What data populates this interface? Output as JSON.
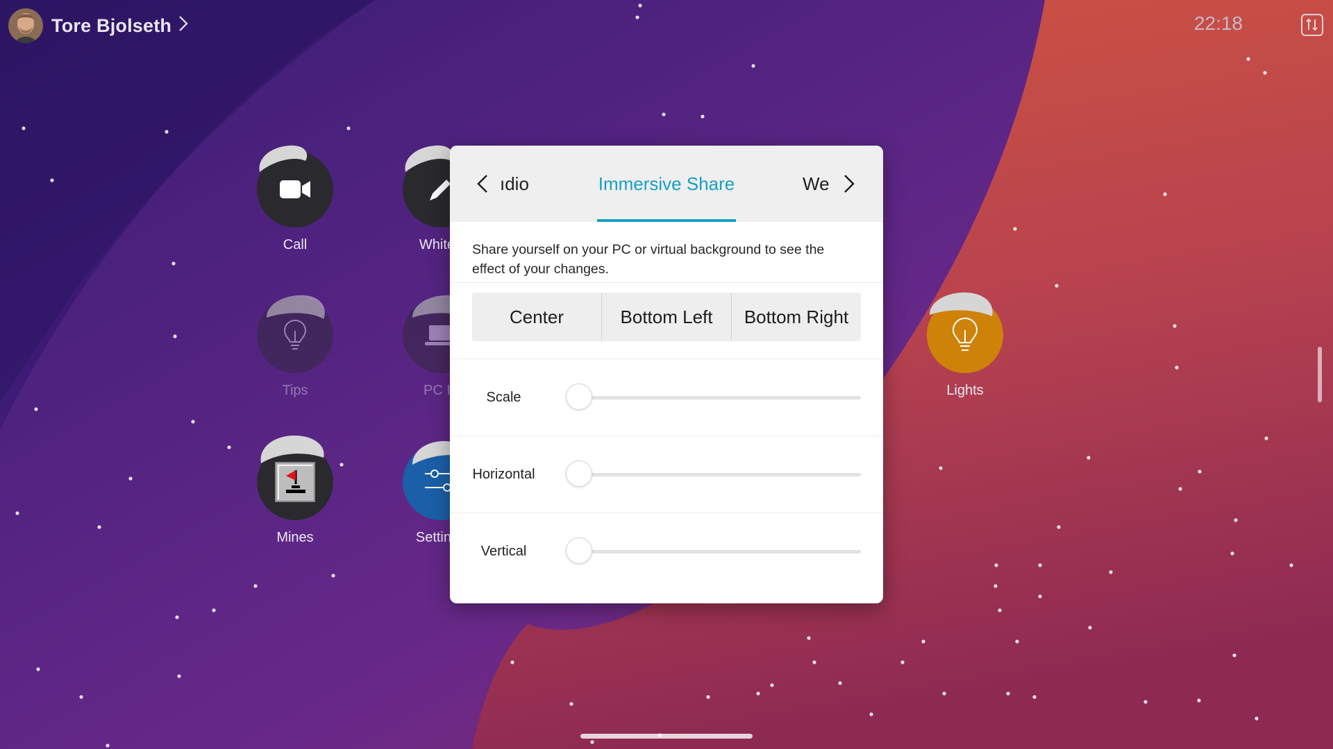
{
  "user": {
    "name": "Tore Bjolseth",
    "chevron": ">"
  },
  "clock": "22:18",
  "tiles": [
    {
      "label": "Call",
      "icon": "video-camera-icon",
      "color": "#2a2a2e"
    },
    {
      "label": "Whiteb",
      "icon": "pen-icon",
      "color": "#2a2a2e"
    },
    {
      "label": "Tips",
      "icon": "lightbulb-icon",
      "color": "#2a2a2e"
    },
    {
      "label": "PC In",
      "icon": "laptop-icon",
      "color": "#2a2a2e"
    },
    {
      "label": "Mines",
      "icon": "minesweeper-flag-icon",
      "color": "#2a2a2e"
    },
    {
      "label": "Settings",
      "icon": "sliders-icon",
      "color": "#1b5fa8"
    },
    {
      "label": "Lights",
      "icon": "lightbulb-icon",
      "color": "#cf8208"
    }
  ],
  "dialog": {
    "prev_tab": "ıdio",
    "active_tab": "Immersive Share",
    "next_tab": "We",
    "description": "Share yourself on your PC or virtual background to see the effect of your changes.",
    "positions": [
      "Center",
      "Bottom Left",
      "Bottom Right"
    ],
    "sliders": [
      {
        "label": "Scale",
        "value": 0
      },
      {
        "label": "Horizontal",
        "value": 0
      },
      {
        "label": "Vertical",
        "value": 0
      }
    ],
    "accent_color": "#15a0c4"
  },
  "colors": {
    "bg_purple": "#3a1c72",
    "bg_orange": "#c8493f",
    "lights_tile": "#cf8208",
    "settings_tile": "#1b5fa8"
  }
}
